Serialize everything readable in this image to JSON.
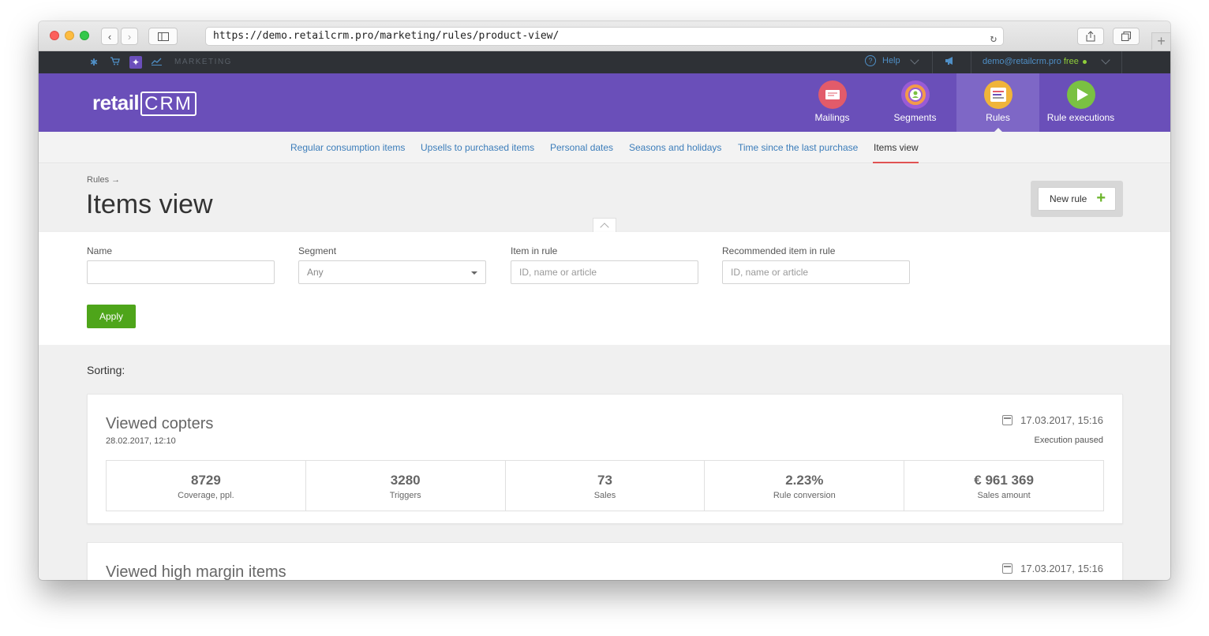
{
  "browser": {
    "url": "https://demo.retailcrm.pro/marketing/rules/product-view/"
  },
  "topbar": {
    "section": "MARKETING",
    "help": "Help",
    "user_email": "demo@retailcrm.pro",
    "plan": "free"
  },
  "header": {
    "logo_text": "retail",
    "logo_crm": "CRM",
    "nav": [
      {
        "label": "Mailings",
        "color": "#e25b6a"
      },
      {
        "label": "Segments",
        "color": "#9a5bd6"
      },
      {
        "label": "Rules",
        "color": "#f0b43a"
      },
      {
        "label": "Rule executions",
        "color": "#7ac142"
      }
    ]
  },
  "subnav": {
    "items": [
      "Regular consumption items",
      "Upsells to purchased items",
      "Personal dates",
      "Seasons and holidays",
      "Time since the last purchase",
      "Items view"
    ]
  },
  "page": {
    "breadcrumb": "Rules →",
    "title": "Items view",
    "new_rule": "New rule"
  },
  "filters": {
    "name_label": "Name",
    "name_value": "",
    "segment_label": "Segment",
    "segment_value": "Any",
    "item_label": "Item in rule",
    "item_placeholder": "ID, name or article",
    "rec_label": "Recommended item in rule",
    "rec_placeholder": "ID, name or article",
    "apply": "Apply"
  },
  "content": {
    "sorting": "Sorting:",
    "rules": [
      {
        "title": "Viewed copters",
        "created": "28.02.2017, 12:10",
        "when": "17.03.2017, 15:16",
        "status": "Execution paused",
        "stats": [
          {
            "value": "8729",
            "label": "Coverage, ppl."
          },
          {
            "value": "3280",
            "label": "Triggers"
          },
          {
            "value": "73",
            "label": "Sales"
          },
          {
            "value": "2.23%",
            "label": "Rule conversion"
          },
          {
            "value": "€ 961 369",
            "label": "Sales amount"
          }
        ]
      },
      {
        "title": "Viewed high margin items",
        "when": "17.03.2017, 15:16"
      }
    ]
  }
}
